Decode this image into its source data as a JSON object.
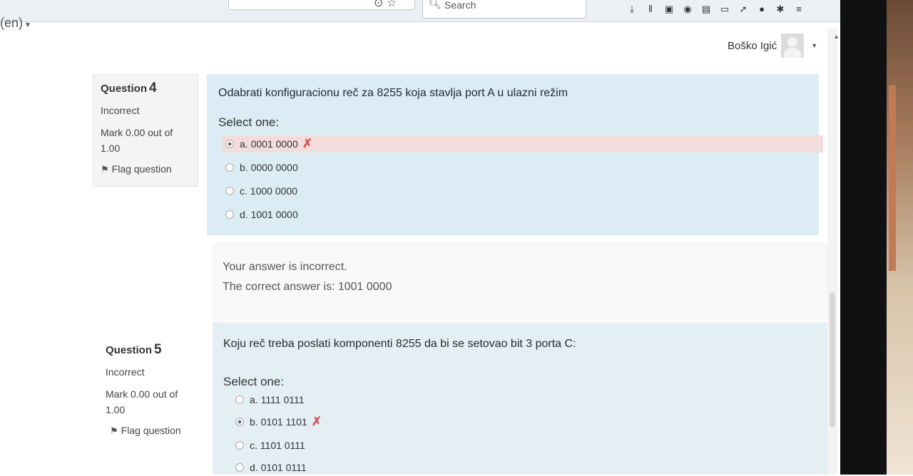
{
  "browser": {
    "search_placeholder": "Search",
    "toolbar_icons": [
      "download-icon",
      "library-icon",
      "reader-icon",
      "account-icon",
      "container-icon",
      "cast-icon",
      "rss-icon",
      "addon-icon",
      "extension-icon",
      "menu-icon"
    ]
  },
  "header": {
    "language": "(en)",
    "user_name": "Boško Igić"
  },
  "questions": [
    {
      "label": "Question",
      "number": "4",
      "state": "Incorrect",
      "grade": "Mark 0.00 out of 1.00",
      "flag": "Flag question",
      "text": "Odabrati konfiguracionu reč za 8255 koja stavlja port A u ulazni režim",
      "prompt": "Select one:",
      "answers": [
        {
          "label": "a. 0001 0000",
          "selected": true,
          "incorrect": true
        },
        {
          "label": "b. 0000 0000",
          "selected": false,
          "incorrect": false
        },
        {
          "label": "c. 1000 0000",
          "selected": false,
          "incorrect": false
        },
        {
          "label": "d. 1001 0000",
          "selected": false,
          "incorrect": false
        }
      ],
      "feedback": "Your answer is incorrect.",
      "correct_answer": "The correct answer is: 1001 0000"
    },
    {
      "label": "Question",
      "number": "5",
      "state": "Incorrect",
      "grade": "Mark 0.00 out of 1.00",
      "flag": "Flag question",
      "text": "Koju reč treba poslati komponenti 8255 da bi se setovao bit 3 porta C:",
      "prompt": "Select one:",
      "answers": [
        {
          "label": "a. 1111 0111",
          "selected": false,
          "incorrect": false
        },
        {
          "label": "b. 0101 1101",
          "selected": true,
          "incorrect": true
        },
        {
          "label": "c. 1101 0111",
          "selected": false,
          "incorrect": false
        },
        {
          "label": "d. 0101 0111",
          "selected": false,
          "incorrect": false
        }
      ]
    }
  ],
  "colors": {
    "question_bg": "#dcecf4",
    "info_bg": "#f4f4f4",
    "incorrect_row": "#f2dcdc",
    "incorrect_mark": "#d9534f"
  }
}
